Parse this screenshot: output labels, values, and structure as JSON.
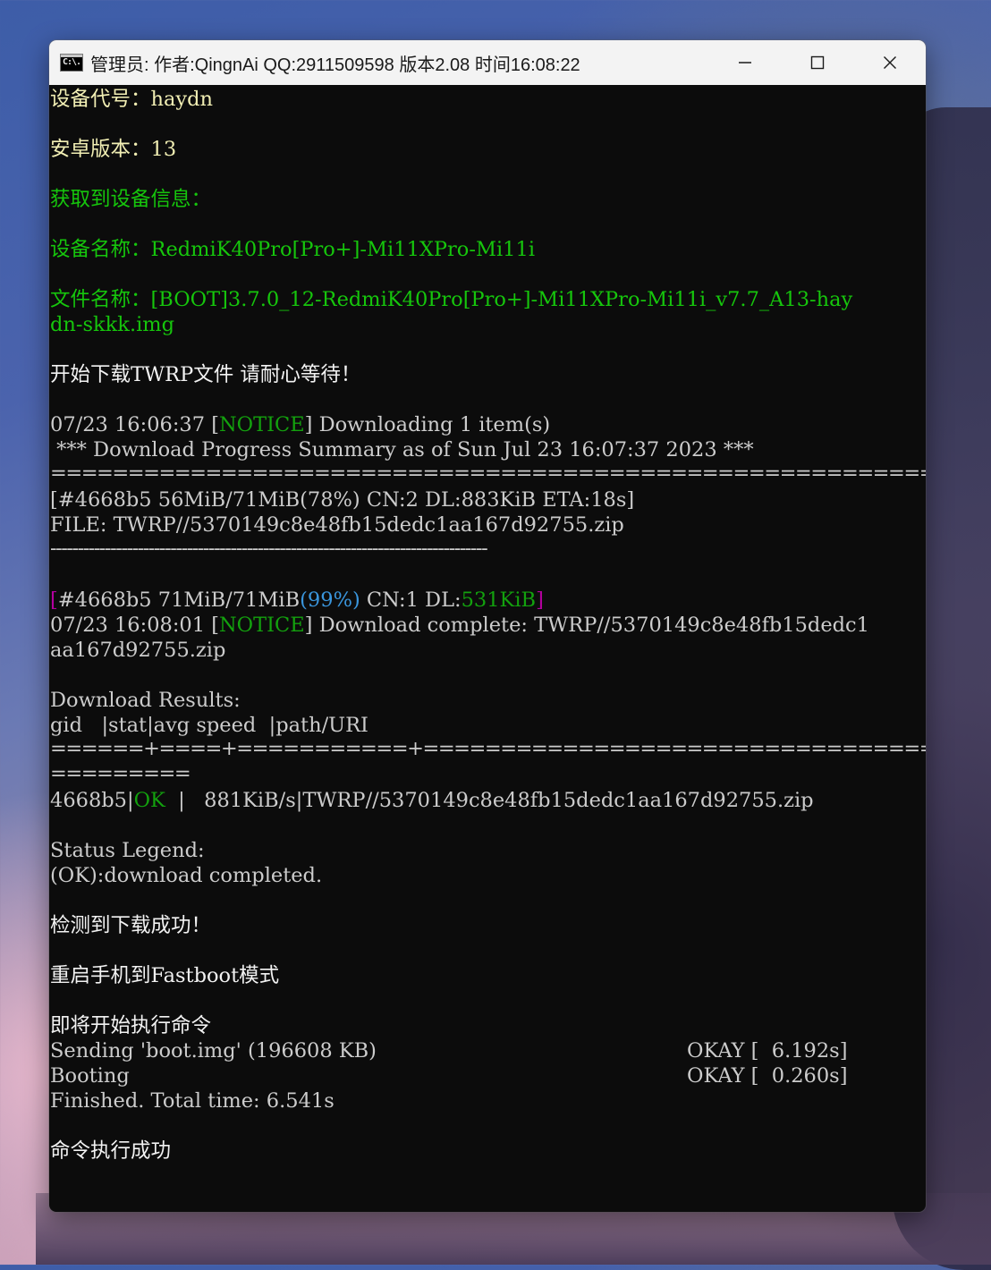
{
  "window": {
    "title": "管理员:  作者:QingnAi QQ:2911509598 版本2.08 时间16:08:22",
    "icon_text": "C:\\.",
    "controls": [
      "minimize-icon",
      "maximize-icon",
      "close-icon"
    ]
  },
  "terminal": {
    "device_code": "设备代号：haydn",
    "android_version": "安卓版本：13",
    "got_device_info": "获取到设备信息：",
    "device_name": "设备名称：RedmiK40Pro[Pro+]-Mi11XPro-Mi11i",
    "file_name_1": "文件名称：[BOOT]3.7.0_12-RedmiK40Pro[Pro+]-Mi11XPro-Mi11i_v7.7_A13-hay",
    "file_name_2": "dn-skkk.img",
    "start_download": "开始下载TWRP文件 请耐心等待！",
    "notice1_ts": "07/23 16:06:37 [",
    "notice1_tag": "NOTICE",
    "notice1_rest": "] Downloading 1 item(s)",
    "summary": " *** Download Progress Summary as of Sun Jul 23 16:07:37 2023 ***",
    "rule_eq": "================================================================================",
    "progress1": "[#4668b5 56MiB/71MiB(78%) CN:2 DL:883KiB ETA:18s]",
    "file_line": "FILE: TWRP//5370149c8e48fb15dedc1aa167d92755.zip",
    "rule_dash": "--------------------------------------------------------------------------------",
    "progress2": {
      "open": "[",
      "id": "#4668b5 71MiB/71MiB",
      "pct": "(99%)",
      "cn": " CN:1 DL:",
      "dl": "531KiB",
      "close": "]"
    },
    "notice2_ts": "07/23 16:08:01 [",
    "notice2_tag": "NOTICE",
    "notice2_rest": "] Download complete: TWRP//5370149c8e48fb15dedc1",
    "notice2_wrap": "aa167d92755.zip",
    "results_title": "Download Results:",
    "results_header": "gid   |stat|avg speed  |path/URI",
    "results_rule": "======+====+===========+===================================================",
    "results_rule_wrap": "=========",
    "result_row": {
      "gid": "4668b5|",
      "stat": "OK",
      "rest": "  |   881KiB/s|TWRP//5370149c8e48fb15dedc1aa167d92755.zip"
    },
    "legend_title": "Status Legend:",
    "legend_ok": "(OK):download completed.",
    "detect_success": "检测到下载成功！",
    "reboot_fastboot": "重启手机到Fastboot模式",
    "about_to_run": "即将开始执行命令",
    "sending": "Sending 'boot.img' (196608 KB)",
    "sending_status": "OKAY [  6.192s]",
    "booting": "Booting",
    "booting_status": "OKAY [  0.260s]",
    "finished": "Finished. Total time: 6.541s",
    "cmd_success": "命令执行成功"
  },
  "colors": {
    "terminal_bg": "#0c0c0c",
    "yellow": "#f2efb4",
    "green": "#16c60c",
    "cyan": "#3a96dd",
    "magenta": "#b4009e"
  }
}
